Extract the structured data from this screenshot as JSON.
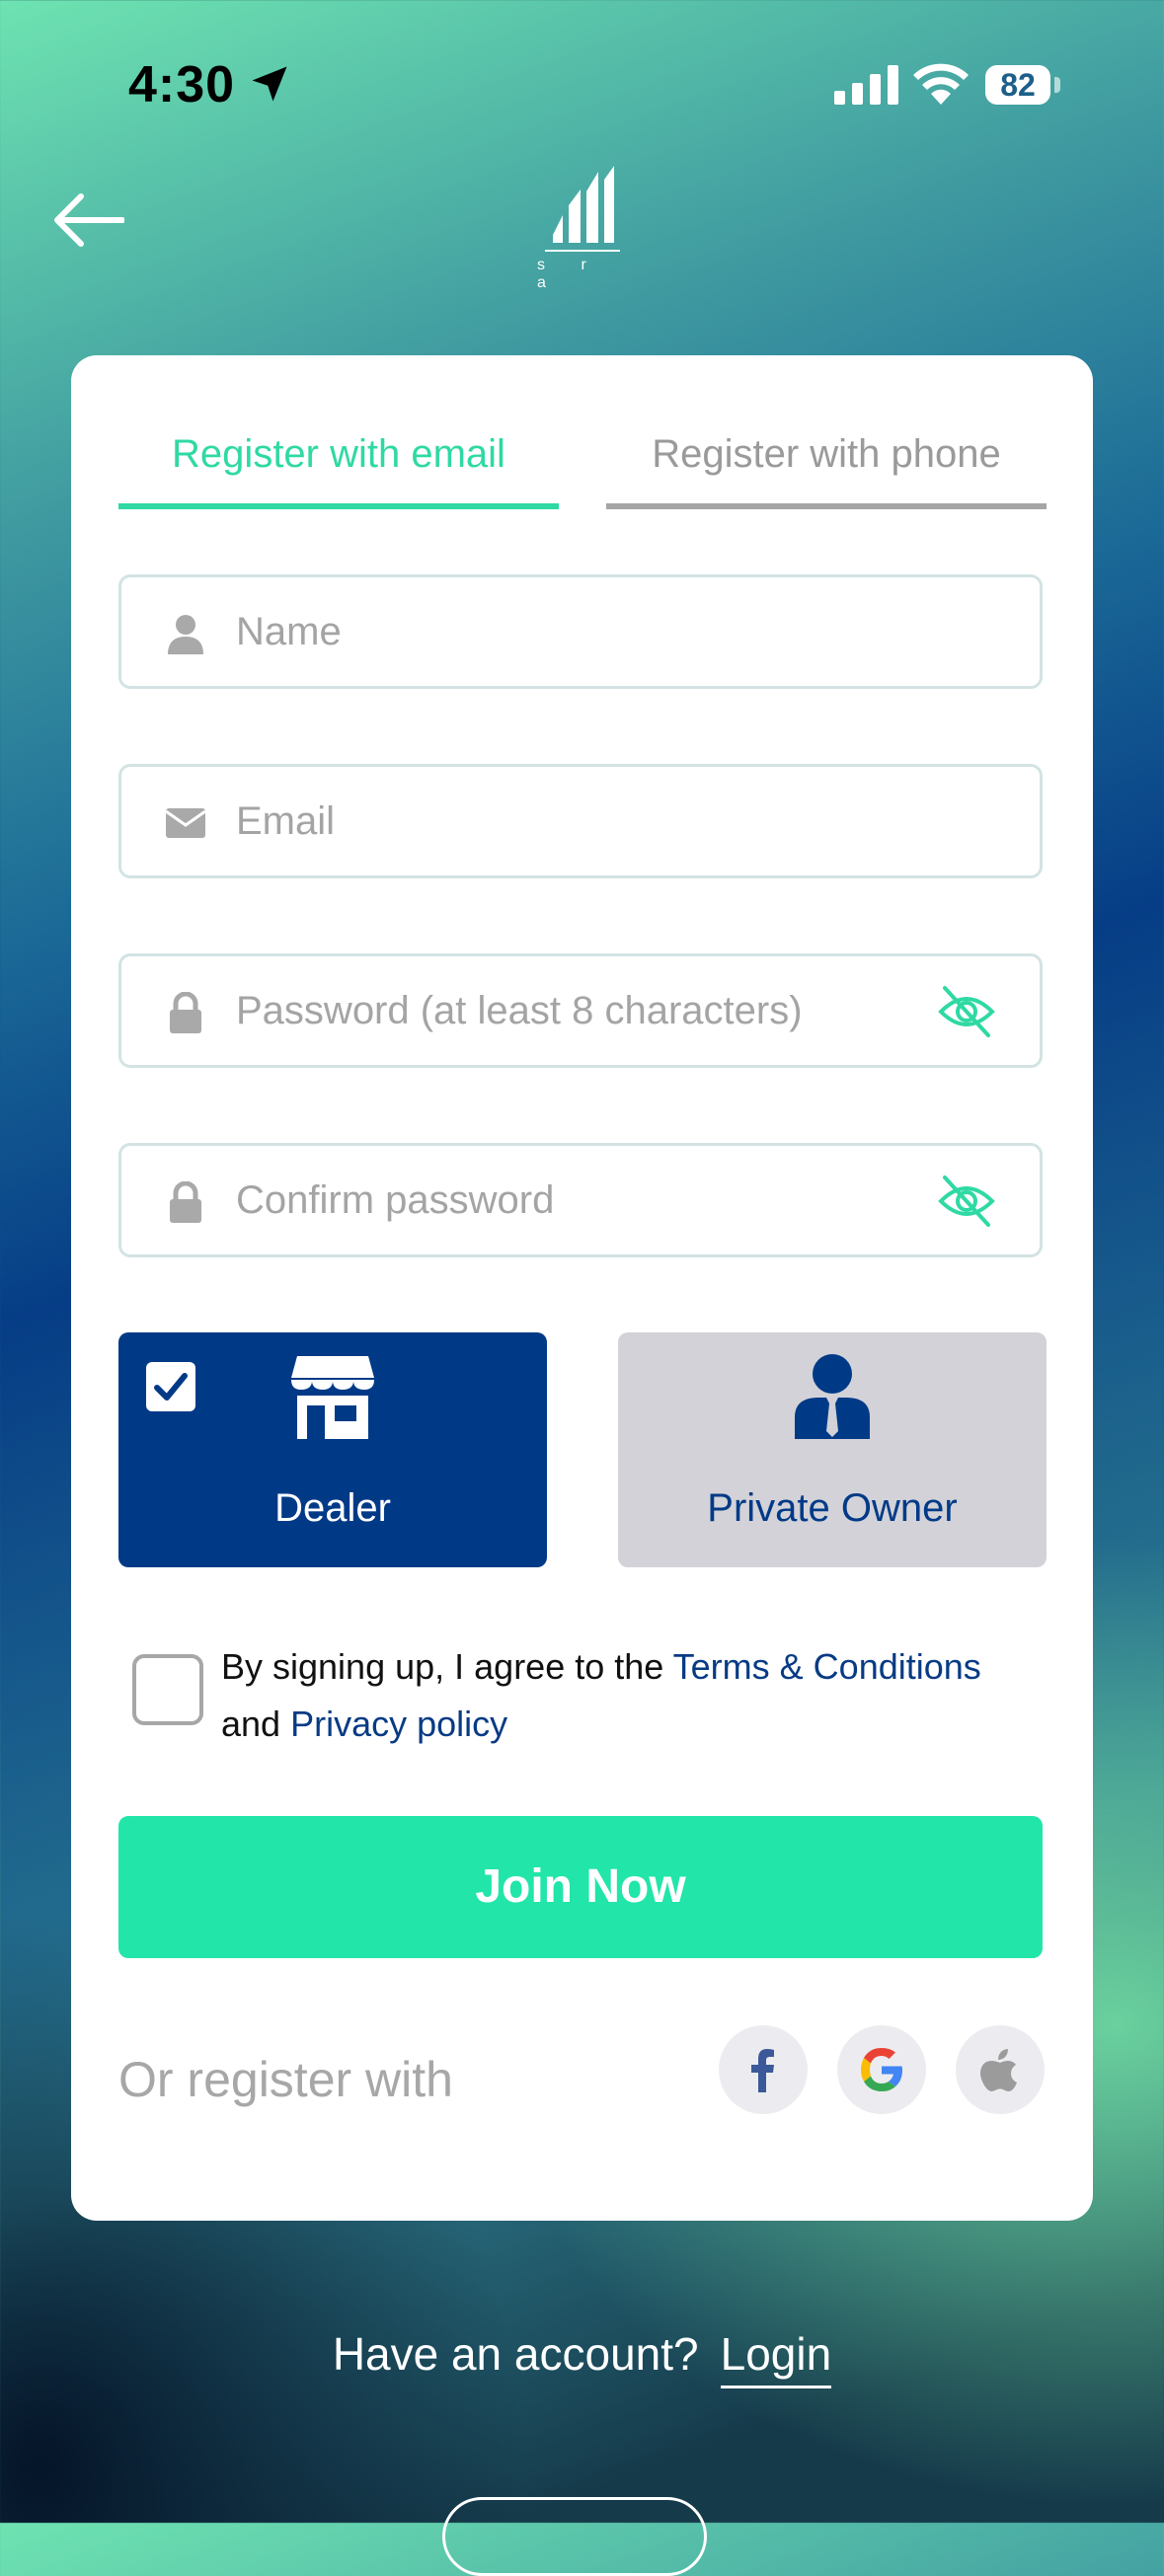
{
  "status_bar": {
    "time": "4:30",
    "battery": "82"
  },
  "header": {
    "logo_sub": "s r a"
  },
  "tabs": [
    {
      "label": "Register with email",
      "active": true
    },
    {
      "label": "Register with phone",
      "active": false
    }
  ],
  "fields": {
    "name_placeholder": "Name",
    "email_placeholder": "Email",
    "password_placeholder": "Password (at least 8 characters)",
    "confirm_placeholder": "Confirm password"
  },
  "roles": [
    {
      "label": "Dealer",
      "selected": true
    },
    {
      "label": "Private Owner",
      "selected": false
    }
  ],
  "agreement": {
    "prefix": "By signing up, I agree to the ",
    "terms_link": "Terms & Conditions",
    "middle": "and ",
    "privacy_link": "Privacy policy",
    "checked": false
  },
  "join_button": "Join Now",
  "social": {
    "label": "Or register with",
    "providers": [
      "facebook-icon",
      "google-icon",
      "apple-icon"
    ]
  },
  "footer": {
    "question": "Have an account?",
    "login": "Login"
  },
  "colors": {
    "accent": "#22e5a9",
    "brand_blue": "#003a87",
    "tab_active": "#2fd9a3"
  }
}
